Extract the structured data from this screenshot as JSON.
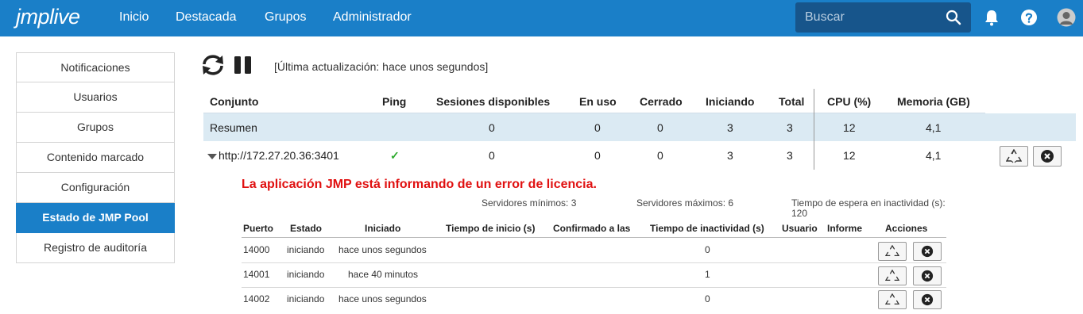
{
  "header": {
    "logo": "jmplive",
    "nav": [
      "Inicio",
      "Destacada",
      "Grupos",
      "Administrador"
    ],
    "search_placeholder": "Buscar",
    "icons": [
      "bell-icon",
      "help-icon",
      "avatar"
    ]
  },
  "sidebar": {
    "items": [
      {
        "label": "Notificaciones"
      },
      {
        "label": "Usuarios"
      },
      {
        "label": "Grupos"
      },
      {
        "label": "Contenido marcado"
      },
      {
        "label": "Configuración"
      },
      {
        "label": "Estado de JMP Pool",
        "active": true
      },
      {
        "label": "Registro de auditoría"
      }
    ]
  },
  "toolbar": {
    "updated_text": "[Última actualización: hace unos segundos]"
  },
  "main_table": {
    "columns": [
      "Conjunto",
      "Ping",
      "Sesiones disponibles",
      "En uso",
      "Cerrado",
      "Iniciando",
      "Total",
      "CPU (%)",
      "Memoria (GB)"
    ],
    "summary": {
      "name": "Resumen",
      "ping": "",
      "available": "0",
      "in_use": "0",
      "closed": "0",
      "starting": "3",
      "total": "3",
      "cpu": "12",
      "memory": "4,1"
    },
    "server": {
      "name": "http://172.27.20.36:3401",
      "ping": "✓",
      "available": "0",
      "in_use": "0",
      "closed": "0",
      "starting": "3",
      "total": "3",
      "cpu": "12",
      "memory": "4,1"
    }
  },
  "detail": {
    "error": "La aplicación JMP está informando de un error de licencia.",
    "min_servers": "Servidores mínimos: 3",
    "max_servers": "Servidores máximos: 6",
    "idle_timeout_label": "Tiempo de espera en inactividad (s):",
    "idle_timeout_value": "120",
    "columns": [
      "Puerto",
      "Estado",
      "Iniciado",
      "Tiempo de inicio (s)",
      "Confirmado a las",
      "Tiempo de inactividad (s)",
      "Usuario",
      "Informe",
      "Acciones"
    ],
    "rows": [
      {
        "port": "14000",
        "state": "iniciando",
        "started": "hace unos segundos",
        "idle": "0"
      },
      {
        "port": "14001",
        "state": "iniciando",
        "started": "hace 40 minutos",
        "idle": "1"
      },
      {
        "port": "14002",
        "state": "iniciando",
        "started": "hace unos segundos",
        "idle": "0"
      }
    ]
  },
  "colors": {
    "brand": "#1a7fc8",
    "error": "#e01010",
    "ok": "#2eaa2e",
    "summary_bg": "#dbeaf3"
  }
}
